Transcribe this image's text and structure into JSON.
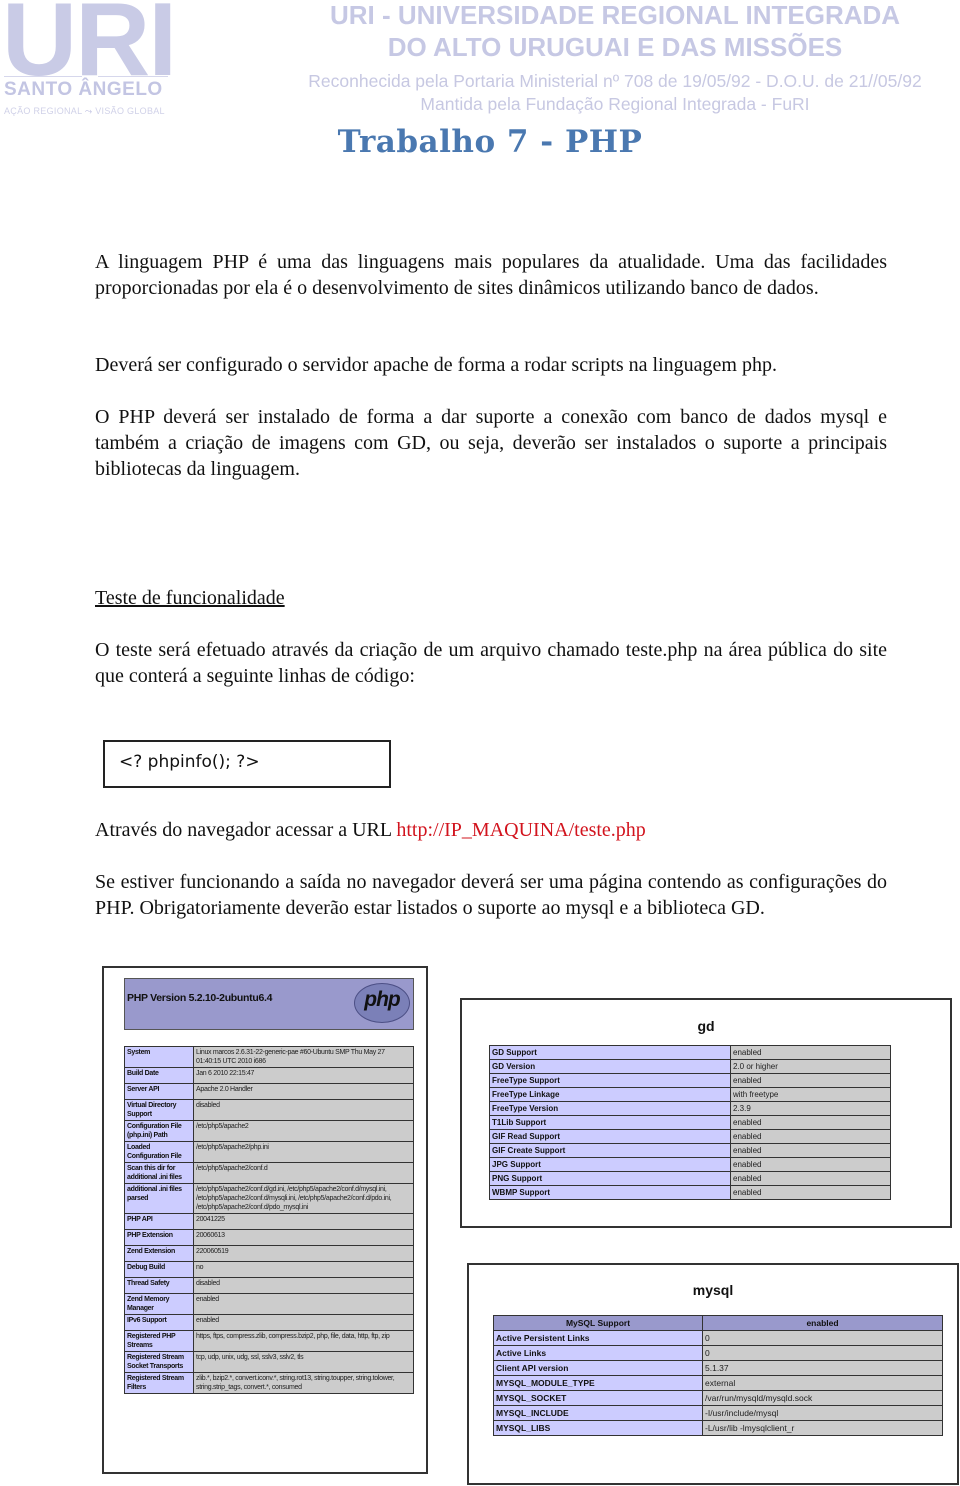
{
  "letterhead": {
    "logo_text": "URI",
    "campus": "SANTO ÂNGELO",
    "tagline_left": "AÇÃO REGIONAL",
    "tagline_right": "VISÃO GLOBAL",
    "university_line1": "URI - UNIVERSIDADE REGIONAL INTEGRADA",
    "university_line2": "DO ALTO URUGUAI E DAS MISSÕES",
    "recognition": "Reconhecida pela Portaria Ministerial nº 708 de 19/05/92 - D.O.U. de 21//05/92",
    "maintainer": "Mantida pela Fundação Regional Integrada - FuRI",
    "color": "#c6c8e4"
  },
  "document": {
    "title": "Trabalho 7 - PHP",
    "title_color": "#4a78b0",
    "paragraphs": {
      "intro": "A linguagem PHP é uma das linguagens mais populares da atualidade. Uma das facilidades proporcionadas por ela é o desenvolvimento de sites dinâmicos utilizando banco de dados.",
      "apache": "Deverá ser configurado o servidor apache de forma a rodar scripts na linguagem php.",
      "install": "O PHP deverá ser instalado de forma a dar suporte a conexão com banco de dados mysql e também a criação de imagens com GD, ou seja, deverão ser instalados o suporte a principais bibliotecas da linguagem.",
      "section_heading": "Teste de funcionalidade",
      "test": "O teste será efetuado através da criação de um arquivo chamado teste.php na área pública do site que conterá a seguinte linhas de código:",
      "url_prefix": "Através do navegador acessar a URL ",
      "url": "http://IP_MAQUINA/teste.php",
      "url_color": "#d2141e",
      "result": "Se estiver funcionando a saída no navegador deverá ser uma página contendo as configurações do PHP. Obrigatoriamente deverão estar listados o suporte ao mysql e a biblioteca GD."
    },
    "code": "<? phpinfo();  ?>"
  },
  "phpinfo": {
    "version": "PHP Version 5.2.10-2ubuntu6.4",
    "logo_text": "php",
    "rows": [
      {
        "key": "System",
        "value": "Linux marcos 2.6.31-22-generic-pae #60-Ubuntu SMP Thu May 27 01:40:15 UTC 2010 i686"
      },
      {
        "key": "Build Date",
        "value": "Jan 6 2010 22:15:47"
      },
      {
        "key": "Server API",
        "value": "Apache 2.0 Handler"
      },
      {
        "key": "Virtual Directory Support",
        "value": "disabled"
      },
      {
        "key": "Configuration File (php.ini) Path",
        "value": "/etc/php5/apache2"
      },
      {
        "key": "Loaded Configuration File",
        "value": "/etc/php5/apache2/php.ini"
      },
      {
        "key": "Scan this dir for additional .ini files",
        "value": "/etc/php5/apache2/conf.d"
      },
      {
        "key": "additional .ini files parsed",
        "value": "/etc/php5/apache2/conf.d/gd.ini, /etc/php5/apache2/conf.d/mysql.ini, /etc/php5/apache2/conf.d/mysqli.ini, /etc/php5/apache2/conf.d/pdo.ini, /etc/php5/apache2/conf.d/pdo_mysql.ini"
      },
      {
        "key": "PHP API",
        "value": "20041225"
      },
      {
        "key": "PHP Extension",
        "value": "20060613"
      },
      {
        "key": "Zend Extension",
        "value": "220060519"
      },
      {
        "key": "Debug Build",
        "value": "no"
      },
      {
        "key": "Thread Safety",
        "value": "disabled"
      },
      {
        "key": "Zend Memory Manager",
        "value": "enabled"
      },
      {
        "key": "IPv6 Support",
        "value": "enabled"
      },
      {
        "key": "Registered PHP Streams",
        "value": "https, ftps, compress.zlib, compress.bzip2, php, file, data, http, ftp, zip"
      },
      {
        "key": "Registered Stream Socket Transports",
        "value": "tcp, udp, unix, udg, ssl, sslv3, sslv2, tls"
      },
      {
        "key": "Registered Stream Filters",
        "value": "zlib.*, bzip2.*, convert.iconv.*, string.rot13, string.toupper, string.tolower, string.strip_tags, convert.*, consumed"
      }
    ]
  },
  "gd": {
    "title": "gd",
    "rows": [
      {
        "key": "GD Support",
        "value": "enabled"
      },
      {
        "key": "GD Version",
        "value": "2.0 or higher"
      },
      {
        "key": "FreeType Support",
        "value": "enabled"
      },
      {
        "key": "FreeType Linkage",
        "value": "with freetype"
      },
      {
        "key": "FreeType Version",
        "value": "2.3.9"
      },
      {
        "key": "T1Lib Support",
        "value": "enabled"
      },
      {
        "key": "GIF Read Support",
        "value": "enabled"
      },
      {
        "key": "GIF Create Support",
        "value": "enabled"
      },
      {
        "key": "JPG Support",
        "value": "enabled"
      },
      {
        "key": "PNG Support",
        "value": "enabled"
      },
      {
        "key": "WBMP Support",
        "value": "enabled"
      }
    ]
  },
  "mysql": {
    "title": "mysql",
    "header": {
      "key": "MySQL Support",
      "value": "enabled"
    },
    "rows": [
      {
        "key": "Active Persistent Links",
        "value": "0"
      },
      {
        "key": "Active Links",
        "value": "0"
      },
      {
        "key": "Client API version",
        "value": "5.1.37"
      },
      {
        "key": "MYSQL_MODULE_TYPE",
        "value": "external"
      },
      {
        "key": "MYSQL_SOCKET",
        "value": "/var/run/mysqld/mysqld.sock"
      },
      {
        "key": "MYSQL_INCLUDE",
        "value": "-I/usr/include/mysql"
      },
      {
        "key": "MYSQL_LIBS",
        "value": "-L/usr/lib -lmysqlclient_r"
      }
    ]
  }
}
